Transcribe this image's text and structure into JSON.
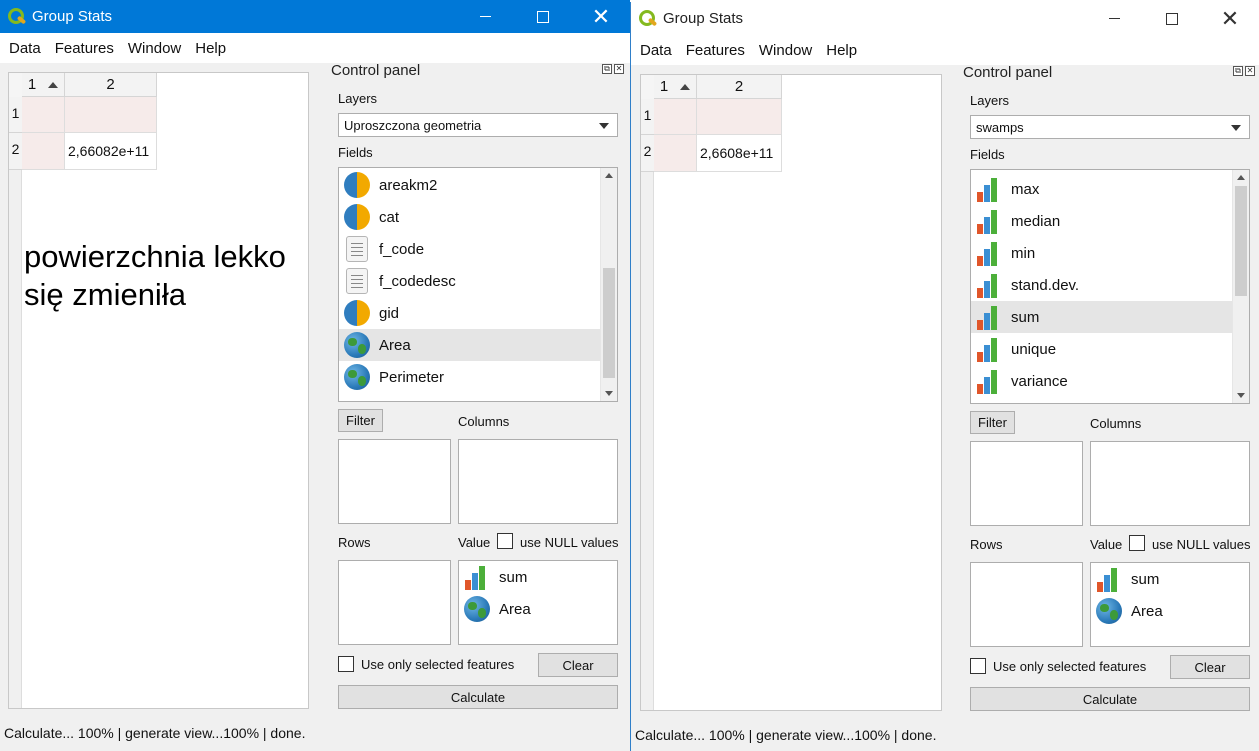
{
  "left": {
    "title": "Group Stats",
    "menu": [
      "Data",
      "Features",
      "Window",
      "Help"
    ],
    "table": {
      "col_headers": [
        "1",
        "2"
      ],
      "row_headers": [
        "1",
        "2"
      ],
      "rows": [
        [
          "",
          ""
        ],
        [
          "",
          "2,66082e+11"
        ]
      ]
    },
    "overlay_text_line1": "powierzchnia lekko",
    "overlay_text_line2": "się zmieniła",
    "panel": {
      "title": "Control panel",
      "layers_label": "Layers",
      "layer_selected": "Uproszczona geometria",
      "fields_label": "Fields",
      "fields": [
        {
          "name": "areakm2",
          "icon": "pie-icon"
        },
        {
          "name": "cat",
          "icon": "pie-icon"
        },
        {
          "name": "f_code",
          "icon": "text-field-icon"
        },
        {
          "name": "f_codedesc",
          "icon": "text-field-icon"
        },
        {
          "name": "gid",
          "icon": "pie-icon"
        },
        {
          "name": "Area",
          "icon": "globe-icon"
        },
        {
          "name": "Perimeter",
          "icon": "globe-icon"
        }
      ],
      "filter_label": "Filter",
      "columns_label": "Columns",
      "rows_label": "Rows",
      "value_label": "Value",
      "use_null_label": "use NULL values",
      "value_items": [
        {
          "name": "sum",
          "icon": "bar-chart-icon"
        },
        {
          "name": "Area",
          "icon": "globe-icon"
        }
      ],
      "use_selected_label": "Use only selected features",
      "clear_label": "Clear",
      "calculate_label": "Calculate"
    },
    "status": "Calculate... 100% |  generate view...100% |  done."
  },
  "right": {
    "title": "Group Stats",
    "menu": [
      "Data",
      "Features",
      "Window",
      "Help"
    ],
    "table": {
      "col_headers": [
        "1",
        "2"
      ],
      "row_headers": [
        "1",
        "2"
      ],
      "rows": [
        [
          "",
          ""
        ],
        [
          "",
          "2,6608e+11"
        ]
      ]
    },
    "panel": {
      "title": "Control panel",
      "layers_label": "Layers",
      "layer_selected": "swamps",
      "fields_label": "Fields",
      "fields": [
        {
          "name": "max",
          "icon": "bar-chart-icon"
        },
        {
          "name": "median",
          "icon": "bar-chart-icon"
        },
        {
          "name": "min",
          "icon": "bar-chart-icon"
        },
        {
          "name": "stand.dev.",
          "icon": "bar-chart-icon"
        },
        {
          "name": "sum",
          "icon": "bar-chart-icon"
        },
        {
          "name": "unique",
          "icon": "bar-chart-icon"
        },
        {
          "name": "variance",
          "icon": "bar-chart-icon"
        }
      ],
      "filter_label": "Filter",
      "columns_label": "Columns",
      "rows_label": "Rows",
      "value_label": "Value",
      "use_null_label": "use NULL values",
      "value_items": [
        {
          "name": "sum",
          "icon": "bar-chart-icon"
        },
        {
          "name": "Area",
          "icon": "globe-icon"
        }
      ],
      "use_selected_label": "Use only selected features",
      "clear_label": "Clear",
      "calculate_label": "Calculate"
    },
    "status": "Calculate... 100% |  generate view...100% |  done."
  },
  "colors": {
    "active_titlebar": "#0078d7",
    "cell_highlight": "#f6ebea",
    "selected_row": "#e5e5e5"
  }
}
